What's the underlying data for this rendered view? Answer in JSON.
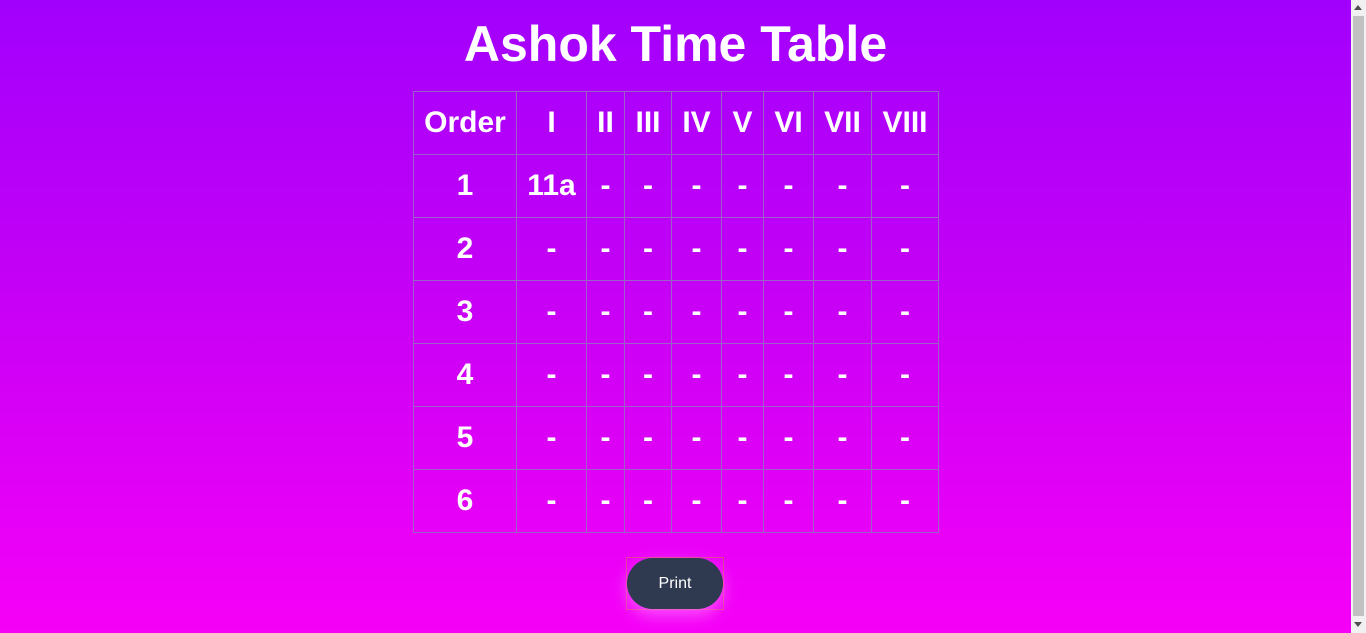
{
  "title": "Ashok Time Table",
  "table": {
    "headers": [
      "Order",
      "I",
      "II",
      "III",
      "IV",
      "V",
      "VI",
      "VII",
      "VIII"
    ],
    "rows": [
      [
        "1",
        "11a",
        "-",
        "-",
        "-",
        "-",
        "-",
        "-",
        "-"
      ],
      [
        "2",
        "-",
        "-",
        "-",
        "-",
        "-",
        "-",
        "-",
        "-"
      ],
      [
        "3",
        "-",
        "-",
        "-",
        "-",
        "-",
        "-",
        "-",
        "-"
      ],
      [
        "4",
        "-",
        "-",
        "-",
        "-",
        "-",
        "-",
        "-",
        "-"
      ],
      [
        "5",
        "-",
        "-",
        "-",
        "-",
        "-",
        "-",
        "-",
        "-"
      ],
      [
        "6",
        "-",
        "-",
        "-",
        "-",
        "-",
        "-",
        "-",
        "-"
      ]
    ]
  },
  "print_button": {
    "label": "Print"
  },
  "colors": {
    "gradient_top": "#a100fd",
    "gradient_bottom": "#f600f7",
    "button_bg": "#2f3a50",
    "text": "#ffffff"
  }
}
